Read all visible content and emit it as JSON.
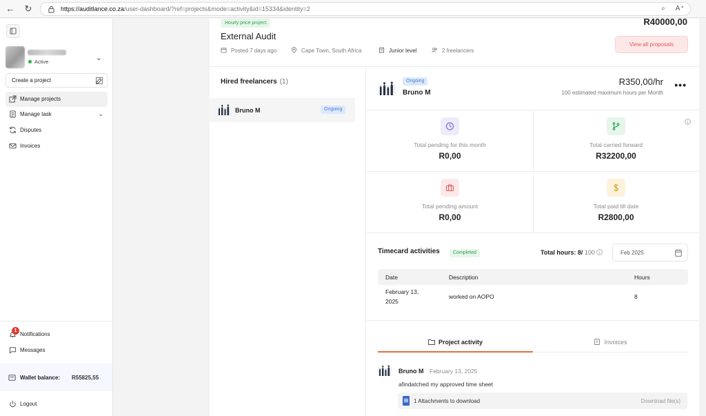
{
  "browser": {
    "url_host": "https://auditlance.co.za",
    "url_rest": "/user-dashboard/?ref=projects&mode=activity&id=15334&identity=2"
  },
  "sidebar": {
    "status": "Active",
    "create_project": "Create a project",
    "items": [
      {
        "label": "Manage projects",
        "icon": "external-link-icon"
      },
      {
        "label": "Manage task",
        "icon": "document-icon"
      },
      {
        "label": "Disputes",
        "icon": "refresh-icon"
      },
      {
        "label": "Invoices",
        "icon": "mail-icon"
      }
    ],
    "bottom": {
      "notifications": "Notifications",
      "notifications_count": "1",
      "messages": "Messages",
      "wallet_label": "Wallet balance:",
      "wallet_value": "R55825,55",
      "logout": "Logout"
    }
  },
  "project": {
    "price_type": "Hourly price project",
    "title": "External Audit",
    "total": "R40000,00",
    "posted": "Posted 7 days ago",
    "location": "Cape Town, South Africa",
    "level": "Junior level",
    "freelancers": "2 freelancers",
    "view_proposals": "View all proposals"
  },
  "hired": {
    "title": "Hired freelancers",
    "count": "(1)",
    "rows": [
      {
        "name": "Bruno M",
        "status": "Ongoing"
      }
    ]
  },
  "detail": {
    "status": "Ongoing",
    "name": "Bruno M",
    "rate": "R350,00/hr",
    "rate_sub": "100 estimated maximum hours per Month",
    "stats": [
      {
        "label": "Total pending for this month",
        "value": "R0,00",
        "icon": "clock-icon",
        "color": "#7b6fd6"
      },
      {
        "label": "Total carried forward",
        "value": "R32200,00",
        "icon": "branch-icon",
        "color": "#2fa34f"
      },
      {
        "label": "Total pending amount",
        "value": "R0,00",
        "icon": "briefcase-icon",
        "color": "#e05a5a"
      },
      {
        "label": "Total paid till date",
        "value": "R2800,00",
        "icon": "dollar-icon",
        "color": "#d7a021"
      }
    ]
  },
  "timecard": {
    "title": "Timecard activities",
    "status": "Completed",
    "hours_label": "Total hours:",
    "hours_value": "8/",
    "hours_max": "100",
    "month": "Feb 2025",
    "columns": [
      "Date",
      "Description",
      "Hours"
    ],
    "rows": [
      {
        "date_line1": "February 13,",
        "date_line2": "2025",
        "description": "worked on AOPO",
        "hours": "8"
      }
    ]
  },
  "tabs": [
    {
      "label": "Project activity",
      "active": true
    },
    {
      "label": "Invoices",
      "active": false
    }
  ],
  "activity": {
    "name": "Bruno M",
    "date": "February 13, 2025",
    "message": "afindatched my approved time sheet",
    "attachment": "1 Attachments to download",
    "download": "Download file(s)"
  }
}
